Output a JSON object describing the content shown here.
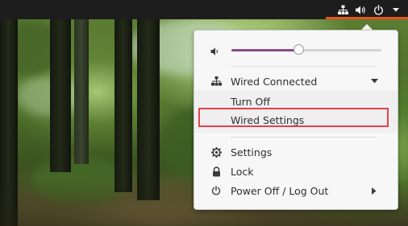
{
  "topbar": {
    "icons": [
      "network-wired-icon",
      "volume-icon",
      "power-icon",
      "dropdown-arrow-icon"
    ],
    "accent_color": "#e95420"
  },
  "menu": {
    "volume": {
      "icon": "volume-icon",
      "level": 0.45,
      "fill_color": "#8a4a8c"
    },
    "network": {
      "icon": "network-wired-icon",
      "label": "Wired Connected",
      "expanded": true,
      "items": [
        {
          "label": "Turn Off"
        },
        {
          "label": "Wired Settings",
          "highlighted": true
        }
      ]
    },
    "items": [
      {
        "icon": "gear-icon",
        "label": "Settings"
      },
      {
        "icon": "lock-icon",
        "label": "Lock"
      },
      {
        "icon": "power-icon",
        "label": "Power Off / Log Out",
        "has_submenu": true
      }
    ],
    "highlight_color": "#e3414b"
  }
}
